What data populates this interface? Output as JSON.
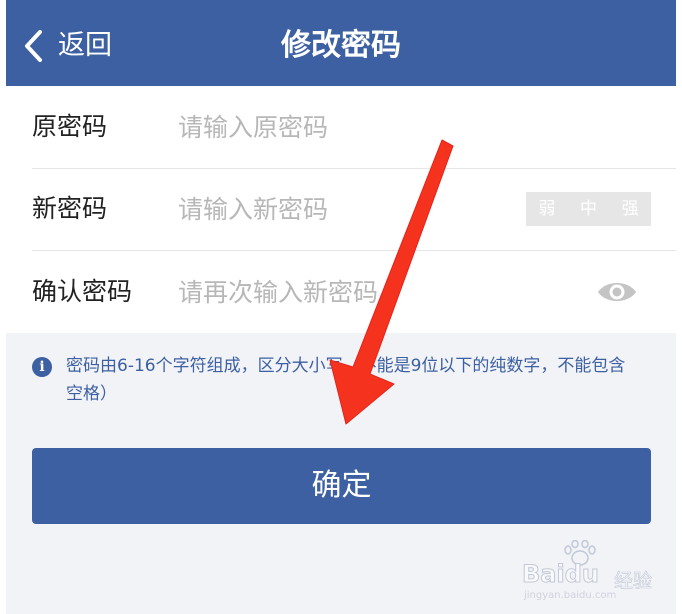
{
  "nav": {
    "back_label": "返回",
    "title": "修改密码"
  },
  "form": {
    "old_password": {
      "label": "原密码",
      "placeholder": "请输入原密码",
      "value": ""
    },
    "new_password": {
      "label": "新密码",
      "placeholder": "请输入新密码",
      "value": ""
    },
    "confirm_password": {
      "label": "确认密码",
      "placeholder": "请再次输入新密码",
      "value": ""
    },
    "strength_levels": [
      "弱",
      "中",
      "强"
    ]
  },
  "hint": {
    "text": "密码由6-16个字符组成，区分大小写（不能是9位以下的纯数字，不能包含空格）"
  },
  "confirm_button": {
    "label": "确定"
  },
  "watermark": {
    "brand": "Baidu",
    "cn": "经验",
    "domain": "jingyan.baidu.com"
  },
  "colors": {
    "accent": "#3c60a2",
    "annotation_arrow": "#f4321e",
    "background": "#f2f3f7",
    "placeholder": "#b7b7b7"
  },
  "icons": {
    "back": "chevron-left-icon",
    "info": "info-icon",
    "eye": "eye-icon",
    "annotation": "red-arrow-icon"
  }
}
